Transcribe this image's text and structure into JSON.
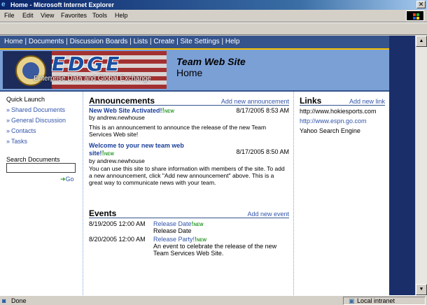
{
  "window": {
    "title": "Home - Microsoft Internet Explorer",
    "close_glyph": "✕"
  },
  "menubar": {
    "items": [
      "File",
      "Edit",
      "View",
      "Favorites",
      "Tools",
      "Help"
    ]
  },
  "nav": {
    "items": [
      "Home",
      "Documents",
      "Discussion Boards",
      "Lists",
      "Create",
      "Site Settings",
      "Help"
    ],
    "separator": "|"
  },
  "banner": {
    "logo_text": "EDGE",
    "logo_tagline": "Enterprise Data and Global Exchange",
    "site_title": "Team Web Site",
    "page_title": "Home"
  },
  "quick_launch": {
    "heading": "Quick Launch",
    "items": [
      "Shared Documents",
      "General Discussion",
      "Contacts",
      "Tasks"
    ],
    "bullet": "»"
  },
  "search": {
    "label": "Search Documents",
    "value": "",
    "go_label": "Go",
    "go_glyph": "➜"
  },
  "announcements": {
    "heading": "Announcements",
    "add_label": "Add new announcement",
    "new_tag": "NEW",
    "new_mark": "!",
    "items": [
      {
        "title": "New Web Site Activated!",
        "date": "8/17/2005 8:53 AM",
        "author": "by andrew.newhouse",
        "body": "This is an announcement to announce the release of the new Team Services Web site!"
      },
      {
        "title_line1": "Welcome to your new team web",
        "title_line2": "site!",
        "date": "8/17/2005 8:50 AM",
        "author": "by andrew.newhouse",
        "body": "You can use this site to share information with members of the site. To add a new announcement, click \"Add new announcement\" above. This is a great way to communicate news with your team."
      }
    ]
  },
  "events": {
    "heading": "Events",
    "add_label": "Add new event",
    "new_tag": "NEW",
    "new_mark": "!",
    "items": [
      {
        "date": "8/19/2005 12:00 AM",
        "title": "Release Date",
        "desc": "Release Date"
      },
      {
        "date": "8/20/2005 12:00 AM",
        "title": "Release Party!",
        "desc": "An event to celebrate the release of the new Team Services Web Site."
      }
    ]
  },
  "links": {
    "heading": "Links",
    "add_label": "Add new link",
    "items": [
      "http://www.hokiesports.com",
      "http://www.espn.go.com",
      "Yahoo Search Engine"
    ]
  },
  "statusbar": {
    "status": "Done",
    "zone": "Local intranet"
  },
  "scroll": {
    "up_glyph": "▲",
    "down_glyph": "▼"
  },
  "colors": {
    "nav_bg": "#35548c",
    "banner_bg": "#7ba0d6",
    "link": "#3355aa",
    "new_tag": "#2a9a2a",
    "accent_stripe": "#f5c000"
  }
}
